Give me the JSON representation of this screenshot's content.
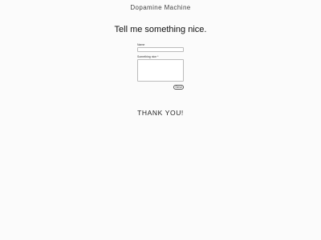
{
  "header": {
    "site_title": "Dopamine Machine"
  },
  "main": {
    "heading": "Tell me something nice.",
    "form": {
      "name_label": "Name",
      "name_value": "",
      "message_label": "Something nice *",
      "message_value": "",
      "send_label": "Send"
    },
    "confirmation": "THANK YOU!"
  }
}
